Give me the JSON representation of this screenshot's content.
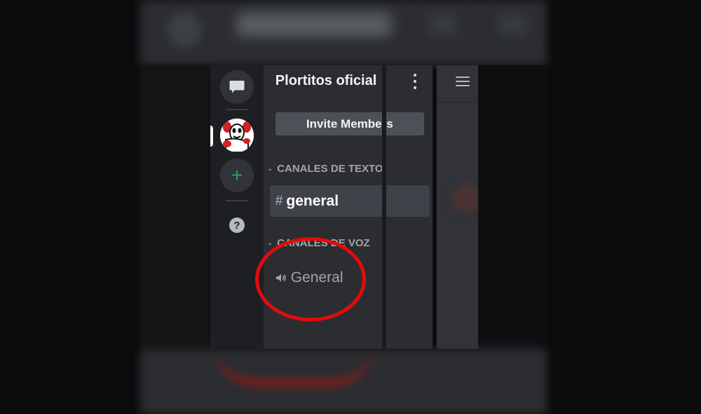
{
  "server": {
    "name": "Plortitos oficial",
    "invite_label": "Invite Members"
  },
  "categories": [
    {
      "label": "CANALES DE TEXTO"
    },
    {
      "label": "CANALES DE VOZ"
    }
  ],
  "channels": {
    "text": [
      {
        "glyph": "#",
        "name": "general",
        "selected": true
      }
    ],
    "voice": [
      {
        "glyph": "🔈",
        "name": "General"
      }
    ]
  },
  "rail": {
    "help_label": "?",
    "add_label": "+"
  },
  "colors": {
    "accent_green": "#23a55a",
    "highlight_red": "#e30b0b",
    "sidebar_bg": "#2b2d31",
    "rail_bg": "#1e1f22"
  },
  "icons": [
    "dm-chat-icon",
    "server-avatar-icon",
    "add-server-icon",
    "help-icon",
    "kebab-menu-icon",
    "hamburger-menu-icon",
    "hash-icon",
    "speaker-icon"
  ]
}
